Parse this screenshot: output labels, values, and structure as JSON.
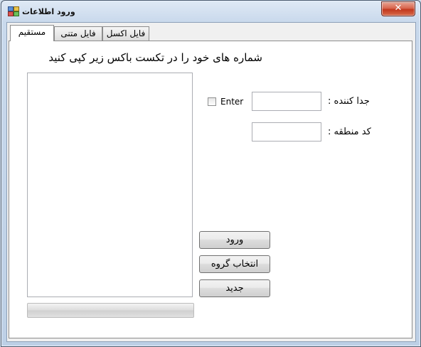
{
  "window": {
    "title": "ورود اطلاعات",
    "close_glyph": "✕"
  },
  "tabs": [
    {
      "label": "مستقیم",
      "active": true
    },
    {
      "label": "فایل متنی",
      "active": false
    },
    {
      "label": "فایل اکسل",
      "active": false
    }
  ],
  "direct_tab": {
    "instruction": "شماره های خود را در تکست باکس زیر کپی کنید",
    "numbers_box_value": "",
    "enter_checkbox": {
      "label": "Enter",
      "checked": false
    },
    "separator": {
      "label": "جدا کننده :",
      "value": ""
    },
    "area_code": {
      "label": "کد منطقه :",
      "value": ""
    },
    "buttons": {
      "enter": "ورود",
      "select_group": "انتخاب گروه",
      "new": "جدید"
    },
    "progress": 0
  },
  "icons": {
    "app": "form-window-icon",
    "close": "close-icon"
  }
}
